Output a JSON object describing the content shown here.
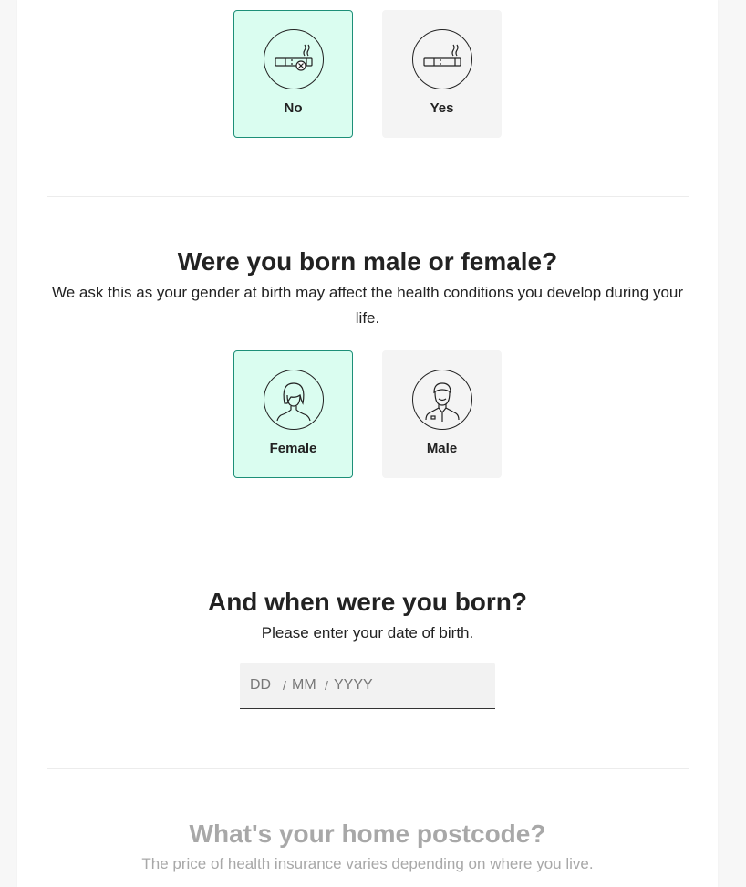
{
  "smoking": {
    "options": [
      {
        "label": "No",
        "icon": "no-smoking-icon",
        "selected": true
      },
      {
        "label": "Yes",
        "icon": "cigarette-icon",
        "selected": false
      }
    ]
  },
  "gender": {
    "title": "Were you born male or female?",
    "subtitle": "We ask this as your gender at birth may affect the health conditions you develop during your life.",
    "options": [
      {
        "label": "Female",
        "icon": "female-avatar-icon",
        "selected": true
      },
      {
        "label": "Male",
        "icon": "male-avatar-icon",
        "selected": false
      }
    ]
  },
  "dob": {
    "title": "And when were you born?",
    "subtitle": "Please enter your date of birth.",
    "day_placeholder": "DD",
    "month_placeholder": "MM",
    "year_placeholder": "YYYY",
    "separator": "/"
  },
  "postcode": {
    "title": "What's your home postcode?",
    "subtitle": "The price of health insurance varies depending on where you live."
  },
  "colors": {
    "selected_bg": "#dafdf0",
    "selected_border": "#1d8f78",
    "unselected_bg": "#f4f4f4"
  }
}
